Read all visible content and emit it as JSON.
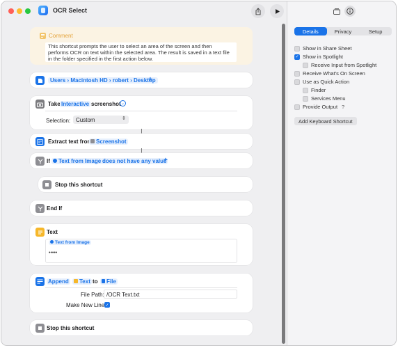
{
  "window": {
    "title": "OCR Select"
  },
  "comment": {
    "heading": "Comment",
    "body": "This shortcut prompts the user to select an area of the screen and then performs OCR on text within the selected area. The result is saved in a text file in the folder specified in the first action below."
  },
  "folder_action": {
    "path": "Users › Macintosh HD › robert › Desktop"
  },
  "screenshot_action": {
    "take": "Take",
    "mode": "Interactive",
    "object": "screenshot",
    "selection_label": "Selection:",
    "selection_value": "Custom"
  },
  "extract_action": {
    "label": "Extract text from",
    "variable": "Screenshot"
  },
  "if_action": {
    "keyword": "If",
    "variable": "Text from Image",
    "condition": "does not have any value"
  },
  "stop_action_1": {
    "label": "Stop this shortcut"
  },
  "endif_action": {
    "label": "End If"
  },
  "text_action": {
    "label": "Text",
    "variable": "Text from Image",
    "content": "•••••"
  },
  "append_action": {
    "verb": "Append",
    "variable": "Text",
    "to": "to",
    "target": "File",
    "file_path_label": "File Path:",
    "file_path_value": "/OCR Text.txt",
    "new_line_label": "Make New Line:"
  },
  "stop_action_2": {
    "label": "Stop this shortcut"
  },
  "inspector": {
    "tabs": [
      "Details",
      "Privacy",
      "Setup"
    ],
    "active_tab": "Details",
    "options": [
      {
        "label": "Show in Share Sheet",
        "checked": false
      },
      {
        "label": "Show in Spotlight",
        "checked": true
      },
      {
        "label": "Receive Input from Spotlight",
        "checked": false
      },
      {
        "label": "Receive What's On Screen",
        "checked": false
      },
      {
        "label": "Use as Quick Action",
        "checked": false
      },
      {
        "label": "Finder",
        "checked": false
      },
      {
        "label": "Services Menu",
        "checked": false
      },
      {
        "label": "Provide Output",
        "checked": false
      }
    ],
    "help_mark": "?",
    "add_shortcut_button": "Add Keyboard Shortcut"
  },
  "colors": {
    "accent": "#1a73e8",
    "comment_bg": "#fbf3e3",
    "comment_heading": "#e4a33a",
    "text_icon": "#f6b72a"
  }
}
